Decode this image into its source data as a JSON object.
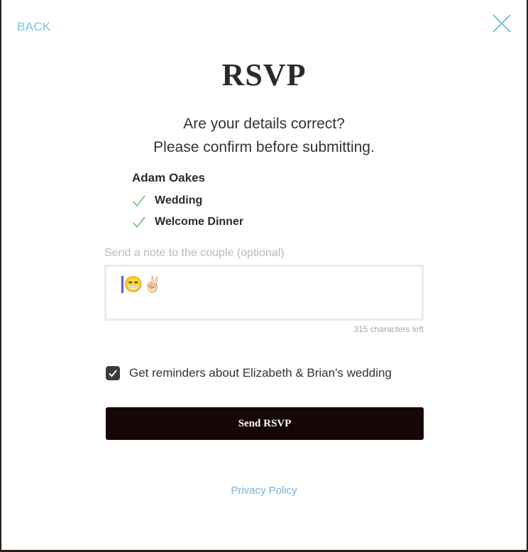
{
  "header": {
    "back_label": "BACK",
    "close_icon": "close-icon",
    "title": "RSVP"
  },
  "confirm": {
    "line1": "Are your details correct?",
    "line2": "Please confirm before submitting."
  },
  "guest": {
    "name": "Adam Oakes",
    "events": [
      {
        "label": "Wedding",
        "icon": "checkmark-icon"
      },
      {
        "label": "Welcome Dinner",
        "icon": "checkmark-icon"
      }
    ]
  },
  "note": {
    "label": "Send a note to the couple (optional)",
    "value": "😁✌🏻",
    "chars_left": "315 characters left"
  },
  "reminders": {
    "checked": true,
    "label": "Get reminders about Elizabeth & Brian's wedding"
  },
  "actions": {
    "send_label": "Send RSVP",
    "privacy_label": "Privacy Policy"
  },
  "colors": {
    "accent_link": "#7cc4df",
    "check_green": "#6cc070",
    "button_bg": "#170606",
    "backdrop": "#2a1f1c"
  }
}
